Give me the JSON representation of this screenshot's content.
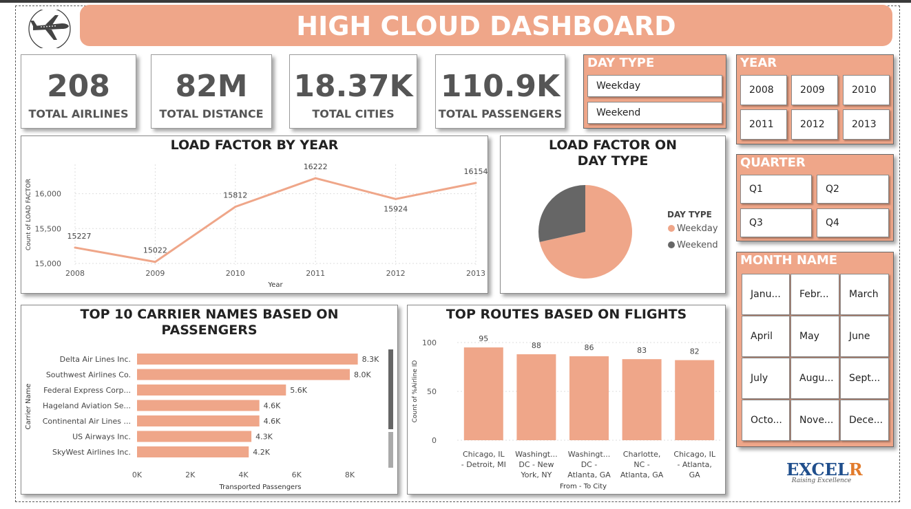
{
  "header": {
    "title": "HIGH CLOUD DASHBOARD",
    "logo_icon": "airplane-icon"
  },
  "kpis": [
    {
      "value": "208",
      "label": "TOTAL AIRLINES"
    },
    {
      "value": "82M",
      "label": "TOTAL DISTANCE"
    },
    {
      "value": "18.37K",
      "label": "TOTAL CITIES"
    },
    {
      "value": "110.9K",
      "label": "TOTAL PASSENGERS"
    }
  ],
  "slicers": {
    "day_type": {
      "title": "DAY TYPE",
      "items": [
        "Weekday",
        "Weekend"
      ]
    },
    "year": {
      "title": "YEAR",
      "items": [
        "2008",
        "2009",
        "2010",
        "2011",
        "2012",
        "2013"
      ]
    },
    "quarter": {
      "title": "QUARTER",
      "items": [
        "Q1",
        "Q2",
        "Q3",
        "Q4"
      ]
    },
    "month": {
      "title": "MONTH NAME",
      "items": [
        "Janu...",
        "Febr...",
        "March",
        "April",
        "May",
        "June",
        "July",
        "Augu...",
        "Sept...",
        "Octo...",
        "Nove...",
        "Dece..."
      ]
    }
  },
  "colors": {
    "accent": "#efa689",
    "dark": "#666666",
    "text": "#555555"
  },
  "brand": {
    "name_main": "EXCEL",
    "name_accent": "R",
    "tagline": "Raising Excellence"
  },
  "chart_data": [
    {
      "type": "line",
      "title": "LOAD FACTOR BY YEAR",
      "x": [
        "2008",
        "2009",
        "2010",
        "2011",
        "2012",
        "2013"
      ],
      "values": [
        15227,
        15022,
        15812,
        16222,
        15924,
        16154
      ],
      "xlabel": "Year",
      "ylabel": "Count of LOAD FACTOR",
      "yticks": [
        "15,000",
        "15,500",
        "16,000"
      ],
      "ytick_values": [
        15000,
        15500,
        16000
      ],
      "ylim": [
        14980,
        16420
      ],
      "color": "#efa689"
    },
    {
      "type": "pie",
      "title": "LOAD FACTOR ON DAY TYPE",
      "legend_title": "DAY TYPE",
      "labels": [
        "Weekday",
        "Weekend"
      ],
      "values": [
        71.5,
        28.5
      ],
      "colors": [
        "#efa689",
        "#666666"
      ],
      "legend": "right"
    },
    {
      "type": "bar",
      "orientation": "horizontal",
      "title": "TOP 10 CARRIER NAMES BASED ON PASSENGERS",
      "categories": [
        "Delta Air Lines Inc.",
        "Southwest Airlines Co.",
        "Federal Express Corp...",
        "Hageland Aviation Se...",
        "Continental Air Lines ...",
        "US Airways Inc.",
        "SkyWest Airlines Inc."
      ],
      "values": [
        8300,
        8000,
        5600,
        4600,
        4600,
        4300,
        4200
      ],
      "data_labels": [
        "8.3K",
        "8.0K",
        "5.6K",
        "4.6K",
        "4.6K",
        "4.3K",
        "4.2K"
      ],
      "xticks": [
        "0K",
        "2K",
        "4K",
        "6K",
        "8K"
      ],
      "xtick_values": [
        0,
        2000,
        4000,
        6000,
        8000
      ],
      "xlim": [
        0,
        8000
      ],
      "xlabel": "Transported Passengers",
      "ylabel": "Carrier Name",
      "color": "#efa689"
    },
    {
      "type": "bar",
      "title": "TOP ROUTES BASED ON FLIGHTS",
      "categories": [
        [
          "Chicago, IL",
          "- Detroit, MI"
        ],
        [
          "Washingt...",
          "DC - New",
          "York, NY"
        ],
        [
          "Washingt...",
          "DC -",
          "Atlanta, GA"
        ],
        [
          "Charlotte,",
          "NC -",
          "Atlanta, GA"
        ],
        [
          "Chicago, IL",
          "- Atlanta,",
          "GA"
        ]
      ],
      "values": [
        95,
        88,
        86,
        83,
        82
      ],
      "yticks": [
        "0",
        "50",
        "100"
      ],
      "ytick_values": [
        0,
        50,
        100
      ],
      "ylim": [
        0,
        100
      ],
      "xlabel": "From - To City",
      "ylabel": "Count of %Airline ID",
      "color": "#efa689"
    }
  ]
}
